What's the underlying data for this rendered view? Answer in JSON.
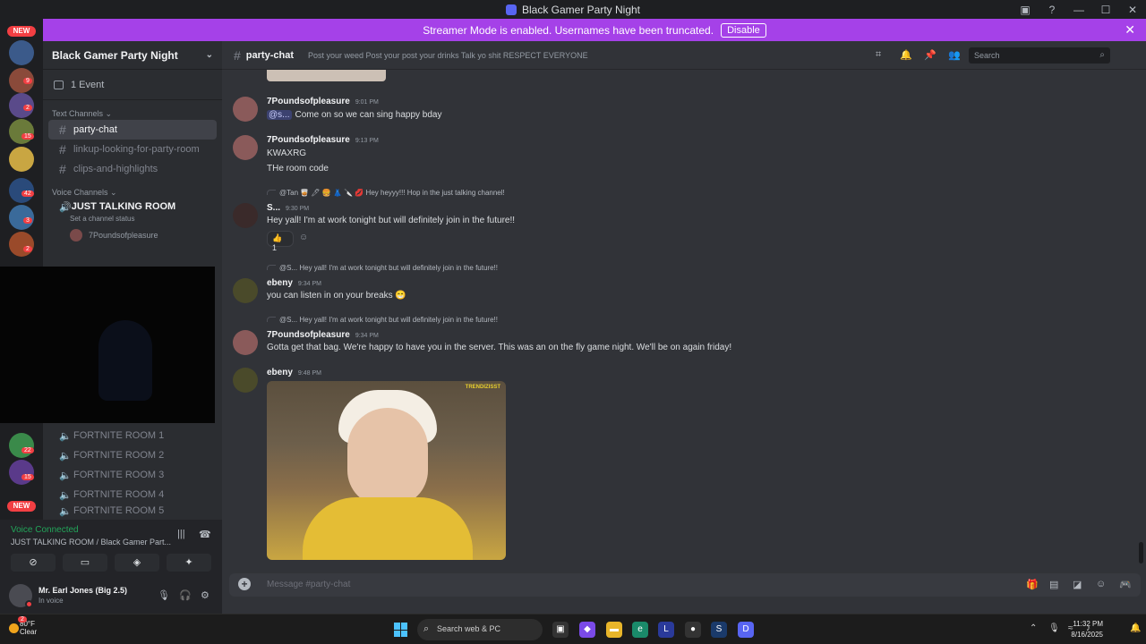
{
  "window": {
    "title": "Black Gamer Party Night"
  },
  "banner": {
    "text": "Streamer Mode is enabled. Usernames have been truncated.",
    "button": "Disable"
  },
  "guild_bar": {
    "new_label": "NEW",
    "badges": [
      "9",
      "2",
      "15",
      "42",
      "3",
      "2",
      "22",
      "15"
    ]
  },
  "sidebar": {
    "server_name": "Black Gamer Party Night",
    "events": "1 Event",
    "text_category": "Text Channels",
    "text_channels": [
      "party-chat",
      "linkup-looking-for-party-room",
      "clips-and-highlights"
    ],
    "voice_category": "Voice Channels",
    "voice_channel": "JUST TALKING ROOM",
    "voice_status": "Set a channel status",
    "voice_user": "7Poundsofpleasure",
    "fortnite_rooms": [
      "FORTNITE ROOM 1",
      "FORTNITE ROOM 2",
      "FORTNITE ROOM 3",
      "FORTNITE ROOM 4",
      "FORTNITE ROOM 5"
    ]
  },
  "voice_panel": {
    "title": "Voice Connected",
    "subtitle": "JUST TALKING ROOM / Black Gamer Part..."
  },
  "user": {
    "name": "Mr. Earl Jones (Big 2.5)",
    "status": "In voice"
  },
  "chat": {
    "channel": "party-chat",
    "topic": "Post your weed Post your post your drinks Talk yo shit RESPECT EVERYONE",
    "search_placeholder": "Search",
    "composer_placeholder": "Message #party-chat",
    "messages": [
      {
        "author": "7Poundsofpleasure",
        "time": "9:01 PM",
        "mention": "@s...",
        "text": "Come on so we can sing happy bday"
      },
      {
        "author": "7Poundsofpleasure",
        "time": "9:13 PM",
        "text": "KWAXRG",
        "text2": "THe  room code"
      },
      {
        "reply": "@Tan 🥃 🖊 🍔 👗 🔪 💋 Hey heyyy!!! Hop in the just talking channel!",
        "author": "S...",
        "time": "9:30 PM",
        "text": "Hey yall! I'm at work tonight but will definitely join in the future!!",
        "reaction": "👍",
        "reaction_count": "1"
      },
      {
        "reply": "@S... Hey yall! I'm at work tonight but will definitely join in the future!!",
        "author": "ebeny",
        "time": "9:34 PM",
        "text": "you can listen in on your breaks 😁"
      },
      {
        "reply": "@S... Hey yall! I'm at work tonight but will definitely join in the future!!",
        "author": "7Poundsofpleasure",
        "time": "9:34 PM",
        "text": "Gotta get that bag. We're happy to have you in the server. This was an on the fly game night. We'll be on again friday!"
      },
      {
        "author": "ebeny",
        "time": "9:48 PM",
        "gif_tag": "TRENDIZISST"
      }
    ]
  },
  "taskbar": {
    "temp": "80°F",
    "condition": "Clear",
    "weather_badge": "2",
    "search": "Search web & PC",
    "time": "11:32 PM",
    "date": "8/16/2025"
  }
}
